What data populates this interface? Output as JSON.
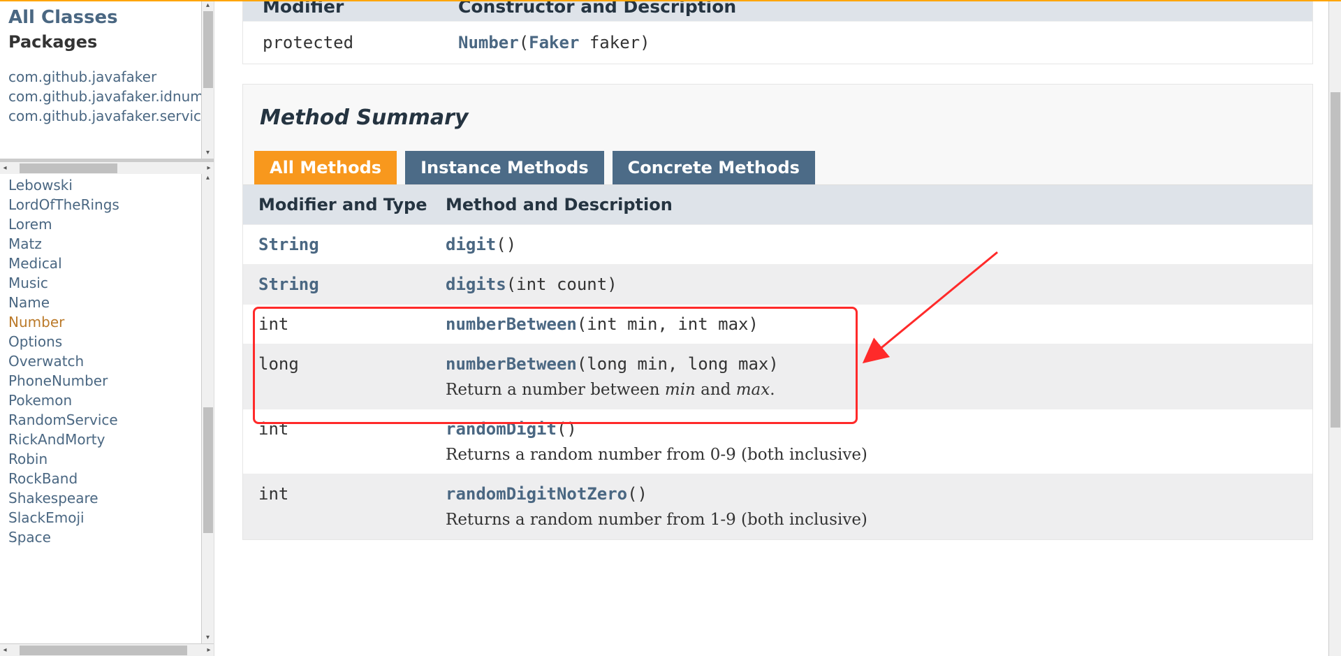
{
  "sidebar": {
    "allClasses": "All Classes",
    "packagesHeading": "Packages",
    "packages": [
      "com.github.javafaker",
      "com.github.javafaker.idnumbers",
      "com.github.javafaker.service"
    ],
    "classes": [
      {
        "name": "Lebowski",
        "selected": false
      },
      {
        "name": "LordOfTheRings",
        "selected": false
      },
      {
        "name": "Lorem",
        "selected": false
      },
      {
        "name": "Matz",
        "selected": false
      },
      {
        "name": "Medical",
        "selected": false
      },
      {
        "name": "Music",
        "selected": false
      },
      {
        "name": "Name",
        "selected": false
      },
      {
        "name": "Number",
        "selected": true
      },
      {
        "name": "Options",
        "selected": false
      },
      {
        "name": "Overwatch",
        "selected": false
      },
      {
        "name": "PhoneNumber",
        "selected": false
      },
      {
        "name": "Pokemon",
        "selected": false
      },
      {
        "name": "RandomService",
        "selected": false
      },
      {
        "name": "RickAndMorty",
        "selected": false
      },
      {
        "name": "Robin",
        "selected": false
      },
      {
        "name": "RockBand",
        "selected": false
      },
      {
        "name": "Shakespeare",
        "selected": false
      },
      {
        "name": "SlackEmoji",
        "selected": false
      },
      {
        "name": "Space",
        "selected": false
      }
    ]
  },
  "constructorSummary": {
    "headerModifier": "Modifier",
    "headerDesc": "Constructor and Description",
    "rows": [
      {
        "modifier": "protected ",
        "name": "Number",
        "faker": "Faker",
        "rest": " faker)"
      }
    ]
  },
  "methodSummary": {
    "title": "Method Summary",
    "tabs": [
      "All Methods",
      "Instance Methods",
      "Concrete Methods"
    ],
    "headerType": "Modifier and Type",
    "headerDesc": "Method and Description",
    "rows": [
      {
        "type": "String",
        "typeLink": true,
        "method": "digit",
        "params": "()",
        "desc": ""
      },
      {
        "type": "String",
        "typeLink": true,
        "method": "digits",
        "params": "(int count)",
        "desc": ""
      },
      {
        "type": "int",
        "typeLink": false,
        "method": "numberBetween",
        "params": "(int min, int max)",
        "desc": ""
      },
      {
        "type": "long",
        "typeLink": false,
        "method": "numberBetween",
        "params": "(long min, long max)",
        "desc": "Return a number between <i>min</i> and <i>max</i>."
      },
      {
        "type": "int",
        "typeLink": false,
        "method": "randomDigit",
        "params": "()",
        "desc": "Returns a random number from 0-9 (both inclusive)"
      },
      {
        "type": "int",
        "typeLink": false,
        "method": "randomDigitNotZero",
        "params": "()",
        "desc": "Returns a random number from 1-9 (both inclusive)"
      }
    ]
  }
}
